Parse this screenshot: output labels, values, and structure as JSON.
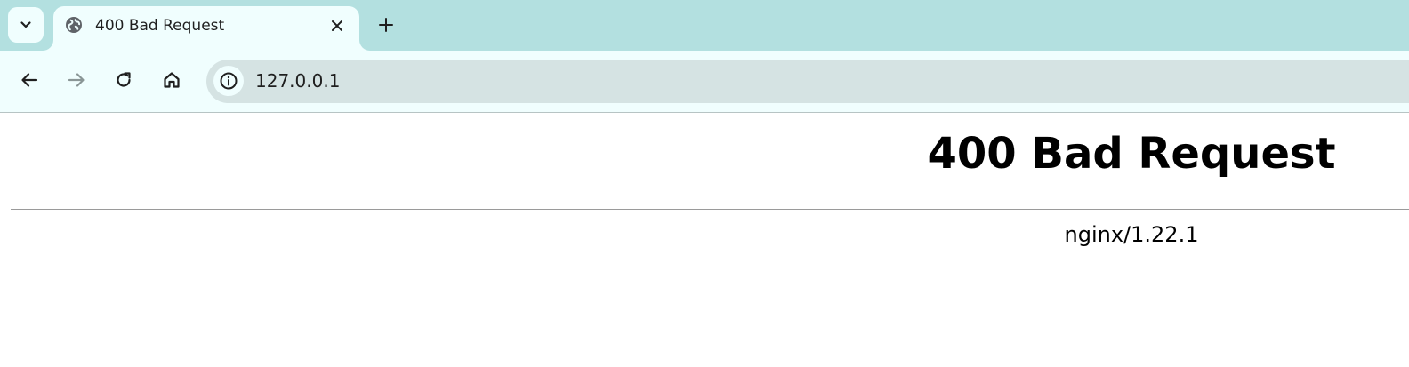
{
  "browser": {
    "tab": {
      "title": "400 Bad Request",
      "favicon": "globe-icon"
    },
    "toolbar": {
      "back_icon": "back-arrow-icon",
      "forward_icon": "forward-arrow-icon",
      "reload_icon": "reload-icon",
      "home_icon": "home-icon",
      "site_info_icon": "info-icon"
    },
    "address_bar": {
      "url": "127.0.0.1"
    }
  },
  "page": {
    "heading": "400 Bad Request",
    "server_signature": "nginx/1.22.1"
  },
  "colors": {
    "tab_strip": "#b3e0e0",
    "toolbar": "#f0fefe",
    "omnibox": "#d5e3e3",
    "page_background": "#ffffff"
  }
}
